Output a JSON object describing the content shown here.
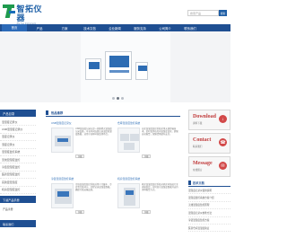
{
  "header": {
    "logo_cn": "智拓仪器",
    "logo_en": "Zhi Tuo Instrument",
    "search_placeholder": "搜索产品",
    "search_button": "搜索"
  },
  "nav": {
    "items": [
      "首页",
      "产品",
      "方案",
      "技术文档",
      "企业新闻",
      "服务支持",
      "公司简介",
      "联系我们"
    ]
  },
  "banner": {
    "dots": 3,
    "active_dot": 1
  },
  "sidebar": {
    "title": "产品目录",
    "items": [
      "温湿度记录仪",
      "USB温湿度记录仪",
      "温度记录仪",
      "湿度记录仪",
      "温湿度监控系统",
      "无线温湿度监控",
      "冷链温湿度监控",
      "医药温湿度监控",
      "实验室温湿度",
      "机房温湿度监控",
      "温湿度传感器"
    ],
    "download_title": "下载产品手册",
    "download_sub": "产品手册",
    "contact_title": "联系我们"
  },
  "center": {
    "title": "热品推荐",
    "products": [
      {
        "title": "USB温湿度记录仪",
        "desc": "USB温湿度记录仪是一款便携式温湿度记录设备，可长时间连续记录温度和湿度数据，适用于各种环境监测场合。",
        "button": "详细"
      },
      {
        "title": "仓库温湿度监控系统",
        "desc": "仓库温湿度监控系统采用无线传输技术，实时监测仓库内温湿度变化，超限自动报警，保障货物储存安全。",
        "button": "详细"
      },
      {
        "title": "冷链温湿度监控系统",
        "desc": "冷链温湿度监控系统适用于冷藏车、冷库等冷链环节，全程记录温湿度数据，确保冷链运输品质。",
        "button": "详细"
      },
      {
        "title": "机房温湿度监控系统",
        "desc": "机房温湿度监控系统对机房环境进行全天候监控，实时显示温湿度数据并支持多种报警方式。",
        "button": "详细"
      }
    ]
  },
  "right": {
    "download": {
      "title": "Download",
      "sub": "资料下载"
    },
    "contact": {
      "title": "Contact",
      "sub": "联系我们"
    },
    "message": {
      "title": "Message",
      "sub": "在线留言"
    },
    "tech_title": "技术文档",
    "tech_items": [
      "温湿度记录仪使用说明",
      "温湿度监控系统方案介绍",
      "无线温湿度监控原理",
      "温湿度记录仪校准方法",
      "冷链温湿度监控方案",
      "医药仓库温湿度验证",
      "机房温湿度标准",
      "温湿度传感器选型"
    ]
  },
  "colors": {
    "primary": "#1f4f92",
    "accent": "#c03b3b",
    "logo_green": "#1f9a4e"
  }
}
